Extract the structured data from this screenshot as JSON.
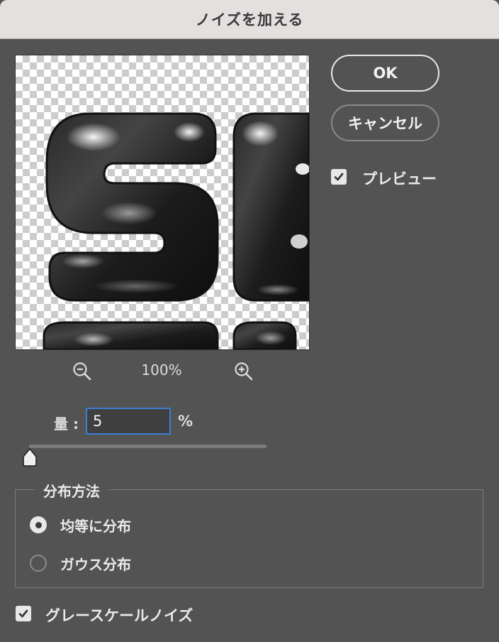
{
  "dialog": {
    "title": "ノイズを加える"
  },
  "buttons": {
    "ok": "OK",
    "cancel": "キャンセル"
  },
  "preview_checkbox": {
    "label": "プレビュー",
    "checked": true
  },
  "preview": {
    "zoom": "100%",
    "zoom_out_icon": "zoom-out-icon",
    "zoom_in_icon": "zoom-in-icon"
  },
  "amount": {
    "label": "量 :",
    "value": "5",
    "unit": "%",
    "slider_fraction": 0.0
  },
  "distribution": {
    "title": "分布方法",
    "options": [
      {
        "label": "均等に分布",
        "selected": true
      },
      {
        "label": "ガウス分布",
        "selected": false
      }
    ]
  },
  "monochromatic": {
    "label": "グレースケールノイズ",
    "checked": true
  },
  "colors": {
    "accent": "#3d7fd6",
    "background": "#535353",
    "titlebar": "#e3e0df"
  }
}
